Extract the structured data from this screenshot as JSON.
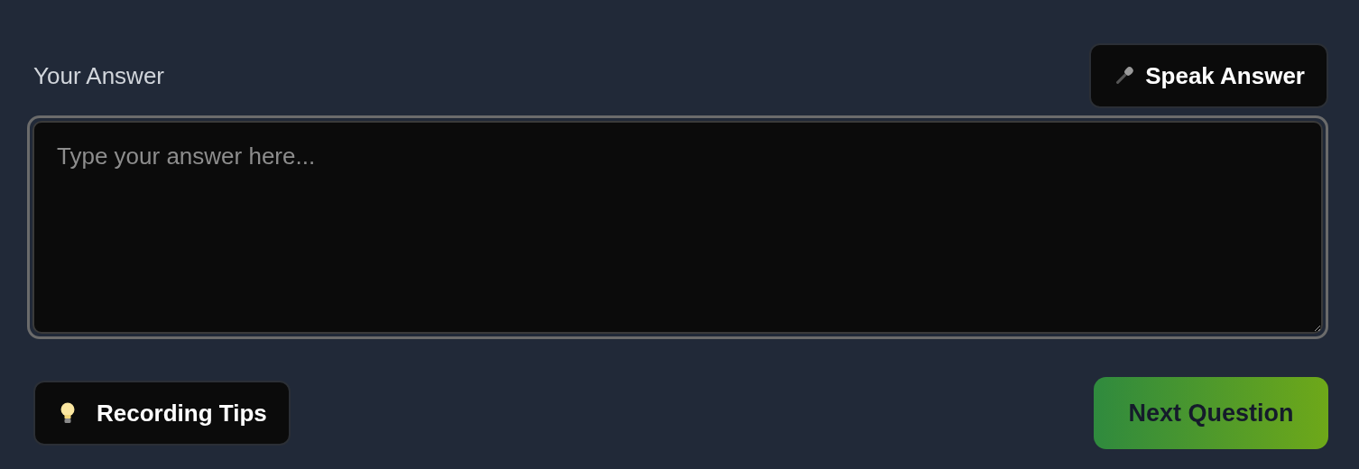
{
  "answer": {
    "label": "Your Answer",
    "placeholder": "Type your answer here..."
  },
  "speak_button": {
    "label": "Speak Answer"
  },
  "tips_button": {
    "label": "Recording Tips"
  },
  "next_button": {
    "label": "Next Question"
  }
}
